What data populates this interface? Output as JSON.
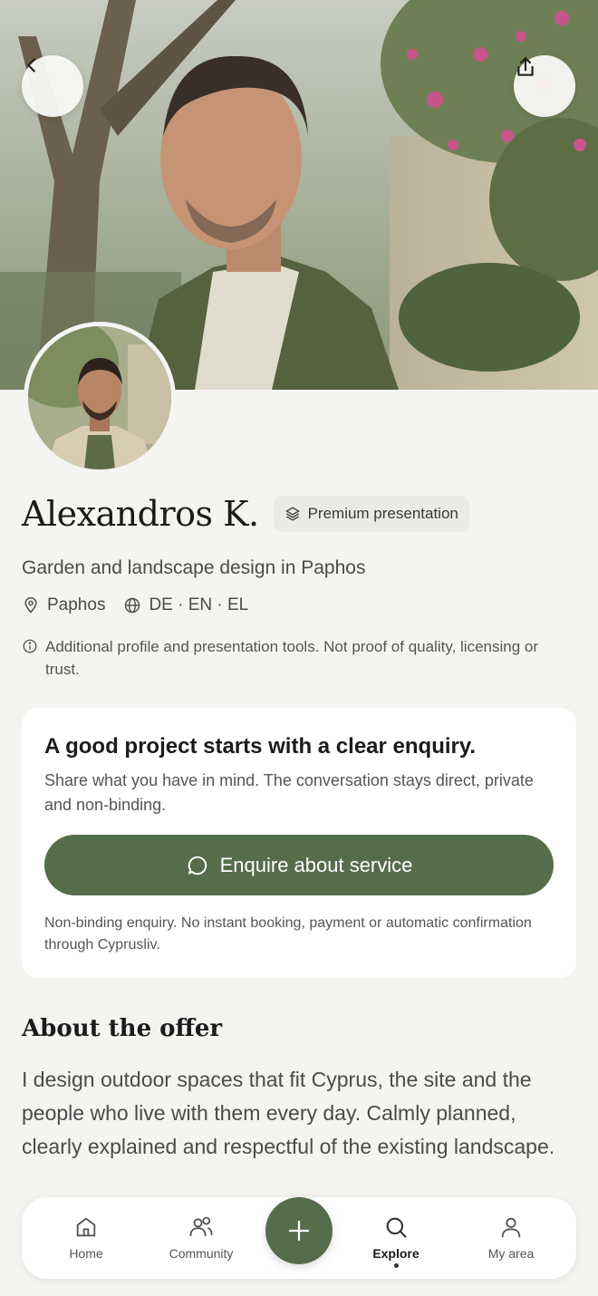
{
  "profile": {
    "name": "Alexandros K.",
    "badge_label": "Premium presentation",
    "subtitle": "Garden and landscape design in Paphos",
    "location": "Paphos",
    "languages": "DE · EN · EL",
    "disclaimer": "Additional profile and presentation tools. Not proof of quality, licensing or trust."
  },
  "enquiry_card": {
    "title": "A good project starts with a clear enquiry.",
    "text": "Share what you have in mind. The conversation stays direct, private and non-binding.",
    "button_label": "Enquire about service",
    "note": "Non-binding enquiry. No instant booking, payment or automatic confirmation through Cyprusliv."
  },
  "about": {
    "title": "About the offer",
    "text": "I design outdoor spaces that fit Cyprus, the site and the people who live with them every day. Calmly planned, clearly explained and respectful of the existing landscape."
  },
  "nav": {
    "home": "Home",
    "community": "Community",
    "explore": "Explore",
    "my_area": "My area",
    "active": "Explore"
  },
  "icons": {
    "back": "chevron-left-icon",
    "share": "share-icon",
    "badge": "layers-icon",
    "location": "map-pin-icon",
    "languages": "globe-icon",
    "info": "info-icon",
    "chat": "chat-bubble-icon",
    "add": "plus-icon"
  },
  "colors": {
    "accent": "#556d4a",
    "background": "#f4f4f1",
    "card": "#ffffff"
  }
}
